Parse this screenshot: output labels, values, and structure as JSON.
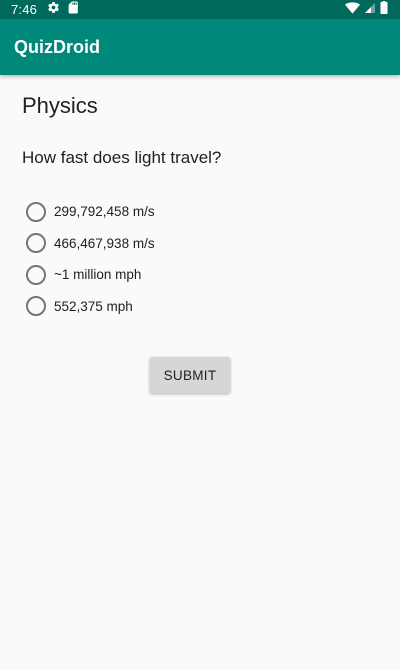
{
  "status_bar": {
    "time": "7:46",
    "left_icons": [
      "gear-icon",
      "sd-card-icon"
    ],
    "right_icons": [
      "wifi-icon",
      "signal-icon",
      "battery-icon"
    ],
    "color": "#00695c"
  },
  "app_bar": {
    "title": "QuizDroid",
    "color": "#00897b"
  },
  "quiz": {
    "category": "Physics",
    "question": "How fast does light travel?",
    "options": [
      {
        "label": "299,792,458 m/s",
        "selected": false
      },
      {
        "label": "466,467,938 m/s",
        "selected": false
      },
      {
        "label": "~1 million mph",
        "selected": false
      },
      {
        "label": "552,375 mph",
        "selected": false
      }
    ],
    "submit_label": "SUBMIT"
  }
}
